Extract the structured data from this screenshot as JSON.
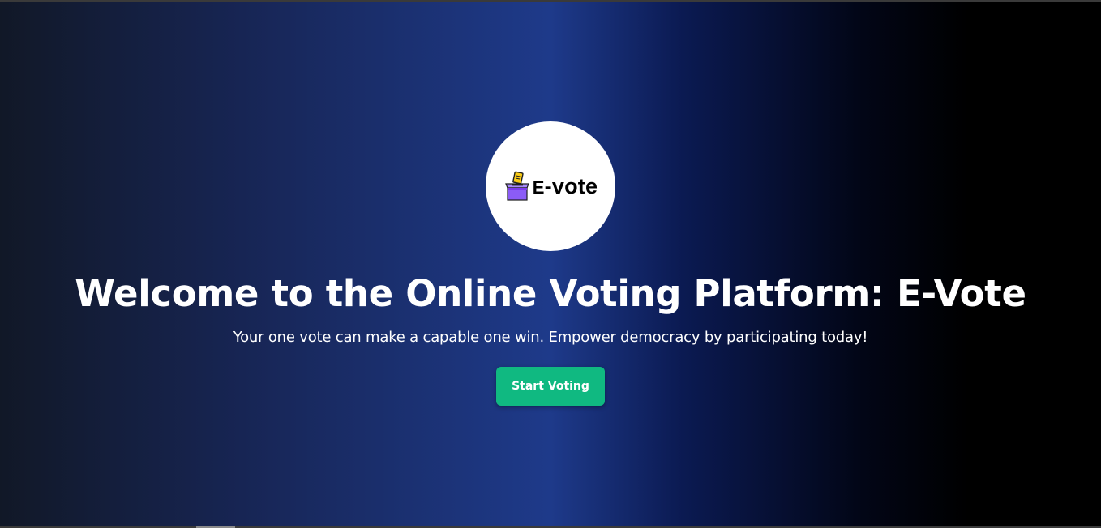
{
  "logo": {
    "text_prefix": "E",
    "text_suffix": "-vote",
    "icon": "ballot-box-icon",
    "icon_color": "#8b5cf6",
    "ballot_color": "#facc15"
  },
  "hero": {
    "title": "Welcome to the Online Voting Platform: E-Vote",
    "subtitle": "Your one vote can make a capable one win. Empower democracy by participating today!",
    "cta_label": "Start Voting"
  },
  "colors": {
    "accent": "#10b981",
    "gradient_center": "#1e3a8a",
    "gradient_left": "#111827",
    "gradient_right": "#000000"
  }
}
